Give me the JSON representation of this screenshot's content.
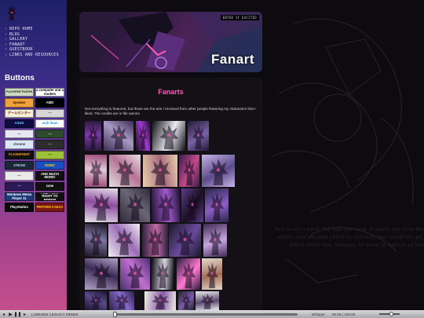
{
  "sidebar": {
    "nav": [
      "REPO HOME",
      "BLOG",
      "GALLERY",
      "FANART",
      "GUESTBOOK",
      "LINKS AND RESOURCES"
    ],
    "buttons_heading": "Buttons",
    "badges": [
      {
        "label": "Accented Fairies",
        "bg": "#cfd8c6",
        "fg": "#223a12"
      },
      {
        "label": "a computer and a modem",
        "bg": "#ffffff",
        "fg": "#000000"
      },
      {
        "label": "Speaker",
        "bg": "#f0a23a",
        "fg": "#3a1200"
      },
      {
        "label": "AMD",
        "bg": "#000000",
        "fg": "#ffffff"
      },
      {
        "label": "ゲームセンター",
        "bg": "#f2eed8",
        "fg": "#a01818"
      },
      {
        "label": "—",
        "bg": "#d7d7d7",
        "fg": "#444444"
      },
      {
        "label": "ASUS",
        "bg": "#0d0d44",
        "fg": "#6fd0ff"
      },
      {
        "label": "arch linux",
        "bg": "#ffffff",
        "fg": "#1793d1"
      },
      {
        "label": "—",
        "bg": "#e8e8f4",
        "fg": "#333333"
      },
      {
        "label": "—",
        "bg": "#2c4a2c",
        "fg": "#d0f0d0"
      },
      {
        "label": "chrome",
        "bg": "#d9e7f7",
        "fg": "#333333"
      },
      {
        "label": "—",
        "bg": "#2d2d2d",
        "fg": "#cccccc"
      },
      {
        "label": "FLASHPOINT",
        "bg": "#111111",
        "fg": "#f5a623"
      },
      {
        "label": "—",
        "bg": "#9cc23a",
        "fg": "#11220a"
      },
      {
        "label": "STEAM",
        "bg": "#1b2838",
        "fg": "#c7d5e0"
      },
      {
        "label": "SONIC",
        "bg": "#1b4fbf",
        "fg": "#ffd800"
      },
      {
        "label": "—",
        "bg": "#eaeaea",
        "fg": "#333333"
      },
      {
        "label": "AND MUCH MORE!",
        "bg": "#111111",
        "fg": "#ffffff"
      },
      {
        "label": "—",
        "bg": "#2a1a58",
        "fg": "#9ad0ff"
      },
      {
        "label": "zune",
        "bg": "#111111",
        "fg": "#ffffff"
      },
      {
        "label": "Windows Media Player 11",
        "bg": "#1c3b78",
        "fg": "#ffffff"
      },
      {
        "label": "I SUPPORT RIGHT TO REPAIR",
        "bg": "#111111",
        "fg": "#ffffff"
      },
      {
        "label": "PlayStation",
        "bg": "#0a0a0a",
        "fg": "#ffffff"
      },
      {
        "label": "PEPORM CA6AA",
        "bg": "#7a1515",
        "fg": "#ffd200"
      }
    ]
  },
  "banner": {
    "tag": "ENTER IF EXCITED",
    "title": "Fanart"
  },
  "content": {
    "heading": "Fanarts",
    "intro": "Not everything is featured, but those are the arts I received from other people featuring my characters that I liked. The credits are in file names."
  },
  "background": {
    "text": "Ren is not a nerd, the maz the nerd. It needs not trow the entire univ weapon entire to her turn, but would the pit, which killed him, because he know th bottom of hea"
  },
  "player": {
    "track": "LUMIXES LEGACY REMIX",
    "app": "Whisper",
    "time": "00:05 | 100:45",
    "progress": 0.0,
    "volume": 0.6
  },
  "gallery": {
    "thumbs": [
      {
        "c1": "#2b1a3d",
        "c2": "#7a3aa6"
      },
      {
        "c1": "#3a2a55",
        "c2": "#a99bc4"
      },
      {
        "c1": "#1a0f22",
        "c2": "#a23ad0"
      },
      {
        "c1": "#0f0f16",
        "c2": "#e9e9ef"
      },
      {
        "c1": "#201933",
        "c2": "#7a62a8"
      },
      {
        "c1": "#9b4a7a",
        "c2": "#e3c7d6"
      },
      {
        "c1": "#e6dfe2",
        "c2": "#b57395"
      },
      {
        "c1": "#e9d2ae",
        "c2": "#a7697c"
      },
      {
        "c1": "#3a1b4a",
        "c2": "#c34a8a"
      },
      {
        "c1": "#c8b3e6",
        "c2": "#5a4b8a"
      },
      {
        "c1": "#e5e2ea",
        "c2": "#8e4ca0"
      },
      {
        "c1": "#2f2a3a",
        "c2": "#6b6676"
      },
      {
        "c1": "#1d1030",
        "c2": "#a05bcc"
      },
      {
        "c1": "#5d3b8c",
        "c2": "#1a0f22"
      },
      {
        "c1": "#29254a",
        "c2": "#8c5fc5"
      },
      {
        "c1": "#1a1420",
        "c2": "#7b74a0"
      },
      {
        "c1": "#f1eef3",
        "c2": "#9a6bb5"
      },
      {
        "c1": "#2b1e3a",
        "c2": "#c16ba7"
      },
      {
        "c1": "#1a1628",
        "c2": "#6a4b9c"
      },
      {
        "c1": "#3e2a54",
        "c2": "#c8a6e0"
      },
      {
        "c1": "#b5a3c8",
        "c2": "#3a2a55"
      },
      {
        "c1": "#4a2f70",
        "c2": "#c070d0"
      },
      {
        "c1": "#0e0d14",
        "c2": "#d6d1e0"
      },
      {
        "c1": "#2a1a40",
        "c2": "#ff7ad0"
      },
      {
        "c1": "#e3d9cf",
        "c2": "#a66d56"
      },
      {
        "c1": "#1b1230",
        "c2": "#5a4a88"
      },
      {
        "c1": "#2a1e44",
        "c2": "#8a6ad0"
      },
      {
        "c1": "#eef1e6",
        "c2": "#8b58a8"
      },
      {
        "c1": "#23232e",
        "c2": "#7b5ca8"
      },
      {
        "c1": "#ece8ef",
        "c2": "#5b4a70"
      },
      {
        "c1": "#241a36",
        "c2": "#a06ac8"
      },
      {
        "c1": "#3d2a60",
        "c2": "#cfc4e0"
      },
      {
        "c1": "#c23a8a",
        "c2": "#2a1838"
      },
      {
        "c1": "#e9e5ee",
        "c2": "#2c2838"
      }
    ]
  }
}
